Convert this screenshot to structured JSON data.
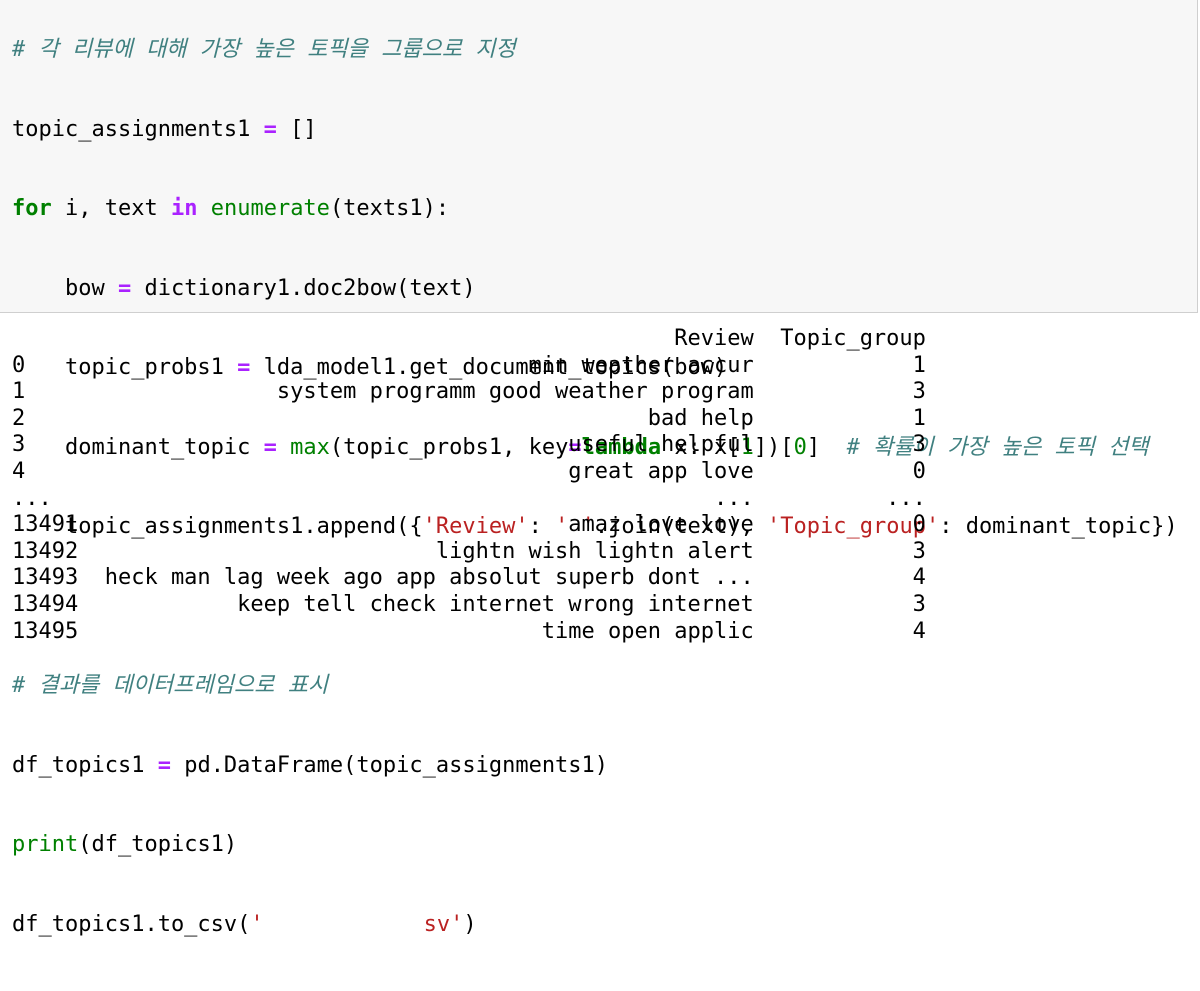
{
  "code": {
    "line0_comment": "# 각 리뷰에 대해 가장 높은 토픽을 그룹으로 지정",
    "line1": {
      "var": "topic_assignments1",
      "rest": " []"
    },
    "line2": {
      "kw_for": "for",
      "mid": " i, text ",
      "kw_in": "in",
      "fn": "enumerate",
      "args": "(texts1):"
    },
    "line3": {
      "var": "    bow ",
      "rest": " dictionary1.doc2bow(text)"
    },
    "line4": {
      "var": "    topic_probs1 ",
      "rest": " lda_model1.get_document_topics(bow)"
    },
    "line5": {
      "var": "    dominant_topic ",
      "fn_max": "max",
      "a": "(topic_probs1, key",
      "kw_lambda": "lambda",
      "b": " x: x[",
      "n1": "1",
      "c": "])[",
      "n0": "0",
      "d": "]  ",
      "comment": "# 확률이 가장 높은 토픽 선택"
    },
    "line6": {
      "a": "    topic_assignments1.append({",
      "s1": "'Review'",
      "b": ": ",
      "s2": "' '",
      "c": ".join(text), ",
      "s3": "'Topic_group'",
      "d": ": dominant_topic})"
    },
    "line8_comment": "# 결과를 데이터프레임으로 표시",
    "line9": {
      "var": "df_topics1 ",
      "rest": " pd.DataFrame(topic_assignments1)"
    },
    "line10": {
      "fn": "print",
      "args": "(df_topics1)"
    },
    "line11": {
      "a": "df_topics1.to_csv(",
      "s_open": "'",
      "s_close": "sv'",
      "b": ")"
    }
  },
  "output": {
    "columns": [
      "Review",
      "Topic_group"
    ],
    "rows": [
      {
        "idx": "0",
        "review": "min weather accur",
        "topic": "1"
      },
      {
        "idx": "1",
        "review": "system programm good weather program",
        "topic": "3"
      },
      {
        "idx": "2",
        "review": "bad help",
        "topic": "1"
      },
      {
        "idx": "3",
        "review": "useful helpful",
        "topic": "3"
      },
      {
        "idx": "4",
        "review": "great app love",
        "topic": "0"
      },
      {
        "idx": "...",
        "review": "...",
        "topic": "..."
      },
      {
        "idx": "13491",
        "review": "amaz love love",
        "topic": "0"
      },
      {
        "idx": "13492",
        "review": "lightn wish lightn alert",
        "topic": "3"
      },
      {
        "idx": "13493",
        "review": "heck man lag week ago app absolut superb dont ...",
        "topic": "4"
      },
      {
        "idx": "13494",
        "review": "keep tell check internet wrong internet",
        "topic": "3"
      },
      {
        "idx": "13495",
        "review": "time open applic",
        "topic": "4"
      }
    ]
  }
}
